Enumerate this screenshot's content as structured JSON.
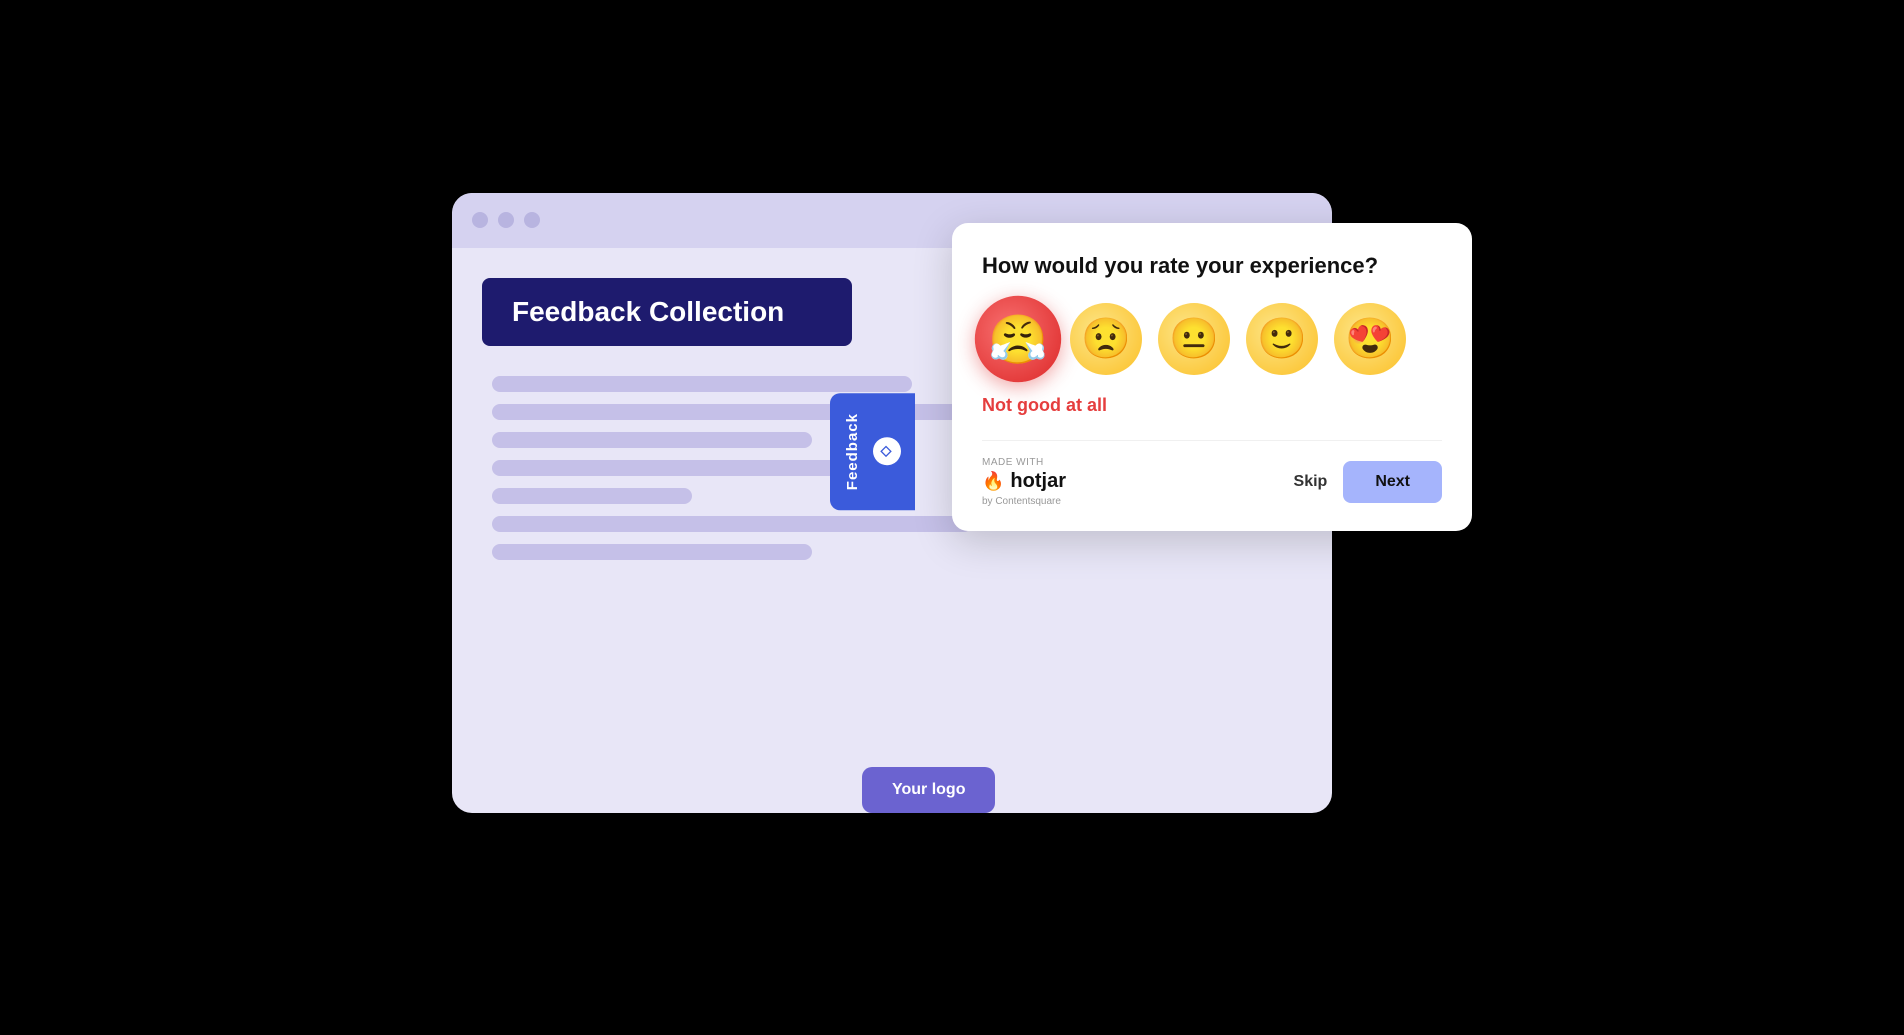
{
  "browser": {
    "dots": [
      "dot1",
      "dot2",
      "dot3"
    ]
  },
  "feedback_label": {
    "text": "Feedback Collection"
  },
  "feedback_tab": {
    "text": "Feedback"
  },
  "logo_badge": {
    "text": "Your logo"
  },
  "survey": {
    "question": "How would you rate your experience?",
    "emojis": [
      {
        "id": "angry",
        "label": "angry-face",
        "symbol": "😤",
        "type": "angry",
        "selected": true
      },
      {
        "id": "sad",
        "label": "sad-face",
        "symbol": "😟",
        "type": "sad",
        "selected": false
      },
      {
        "id": "neutral",
        "label": "neutral-face",
        "symbol": "😐",
        "type": "neutral",
        "selected": false
      },
      {
        "id": "happy",
        "label": "happy-face",
        "symbol": "🙂",
        "type": "happy",
        "selected": false
      },
      {
        "id": "love",
        "label": "love-face",
        "symbol": "😍",
        "type": "love",
        "selected": false
      }
    ],
    "selected_label": "Not good at all",
    "made_with_label": "MADE WITH",
    "brand_name": "hotjar",
    "by_label": "by Contentsquare",
    "skip_label": "Skip",
    "next_label": "Next"
  },
  "colors": {
    "accent_dark": "#1e1b6e",
    "accent_blue": "#3b5bdb",
    "accent_purple": "#a5b4fc",
    "angry_red": "#dc2626",
    "emoji_yellow": "#fbbf24"
  }
}
